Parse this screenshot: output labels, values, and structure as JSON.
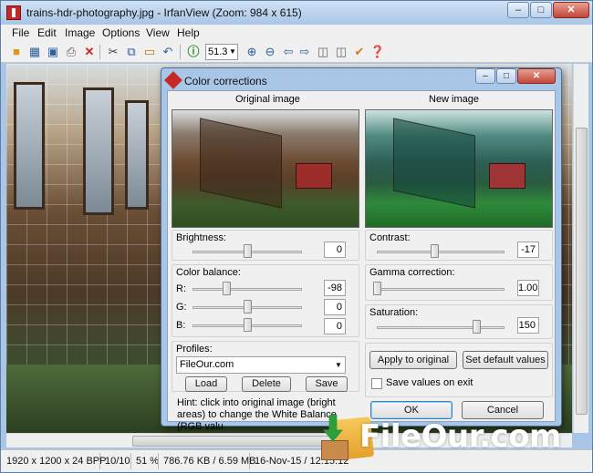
{
  "window": {
    "title": "trains-hdr-photography.jpg - IrfanView (Zoom: 984 x 615)",
    "minimize_label": "–",
    "maximize_label": "□",
    "close_label": "✕"
  },
  "menu": [
    "File",
    "Edit",
    "Image",
    "Options",
    "View",
    "Help"
  ],
  "toolbar": {
    "zoom_value": "51.3",
    "icons": [
      "open-folder-icon",
      "thumbnails-icon",
      "save-icon",
      "print-icon",
      "delete-icon",
      "cut-icon",
      "copy-icon",
      "paste-icon",
      "undo-icon",
      "info-icon",
      "zoom-in-icon",
      "zoom-out-icon",
      "previous-icon",
      "next-icon",
      "slideshow-icon",
      "effects-icon",
      "paint-icon",
      "help-icon"
    ]
  },
  "statusbar": {
    "dimensions": "1920 x 1200 x 24 BPP",
    "index": "10/10",
    "zoom": "51 %",
    "filesize": "786.76 KB / 6.59 MB",
    "datetime": "16-Nov-15 / 12:15:12"
  },
  "dialog": {
    "title": "Color corrections",
    "original_label": "Original image",
    "new_label": "New image",
    "brightness": {
      "label": "Brightness:",
      "value": "0",
      "level": 0.5
    },
    "color_balance": {
      "label": "Color balance:",
      "r": {
        "label": "R:",
        "value": "-98",
        "level": 0.31
      },
      "g": {
        "label": "G:",
        "value": "0",
        "level": 0.5
      },
      "b": {
        "label": "B:",
        "value": "0",
        "level": 0.5
      }
    },
    "contrast": {
      "label": "Contrast:",
      "value": "-17",
      "level": 0.45
    },
    "gamma": {
      "label": "Gamma correction:",
      "value": "1.00",
      "level": 0.0
    },
    "saturation": {
      "label": "Saturation:",
      "value": "150",
      "level": 0.78
    },
    "profiles": {
      "label": "Profiles:",
      "selected": "FileOur.com",
      "load_label": "Load",
      "delete_label": "Delete",
      "save_label": "Save"
    },
    "apply_original_label": "Apply to original",
    "set_defaults_label": "Set default values",
    "save_on_exit_label": "Save values on exit",
    "save_on_exit_checked": false,
    "ok_label": "OK",
    "cancel_label": "Cancel",
    "hint": "Hint: click into original image (bright areas) to change the White Balance (RGB valu"
  },
  "watermark": {
    "text": "FileOur.com"
  },
  "colors": {
    "accent": "#a9c6e6",
    "close": "#c0463a",
    "watermark_green": "#2e9e3a"
  }
}
